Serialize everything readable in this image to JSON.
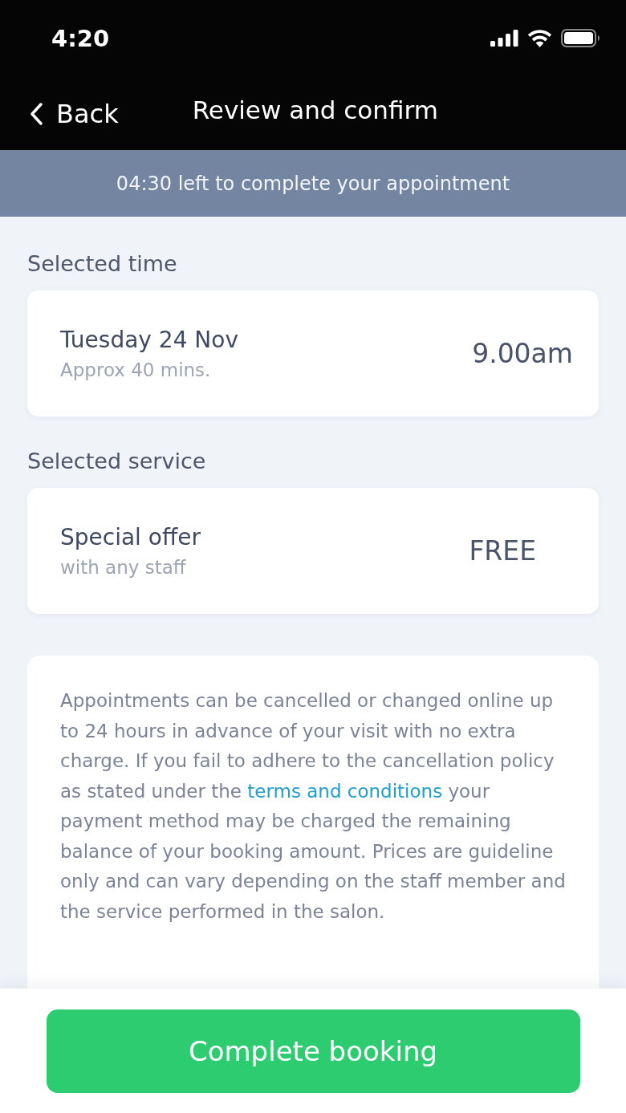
{
  "status_bar": {
    "time": "4:20"
  },
  "nav": {
    "back": "Back",
    "title": "Review and confirm"
  },
  "timer_banner": "04:30 left to complete your appointment",
  "sections": [
    {
      "kind": "time",
      "heading": "Selected time",
      "title": "Tuesday 24 Nov",
      "subtitle": "Approx 40 mins.",
      "value": "9.00am"
    },
    {
      "kind": "service",
      "heading": "Selected service",
      "title": "Special offer",
      "subtitle": "with any staff",
      "value": "FREE"
    }
  ],
  "policy": {
    "before": "Appointments can be cancelled or changed online up to 24 hours in advance of your visit with no extra charge. If you fail to adhere to the cancellation policy as stated under the ",
    "link": "terms and conditions",
    "after": " your payment method may be charged the remaining balance of your booking amount. Prices are guideline only and can vary depending on the staff member and the service performed in the salon."
  },
  "primary_button": "Complete booking"
}
